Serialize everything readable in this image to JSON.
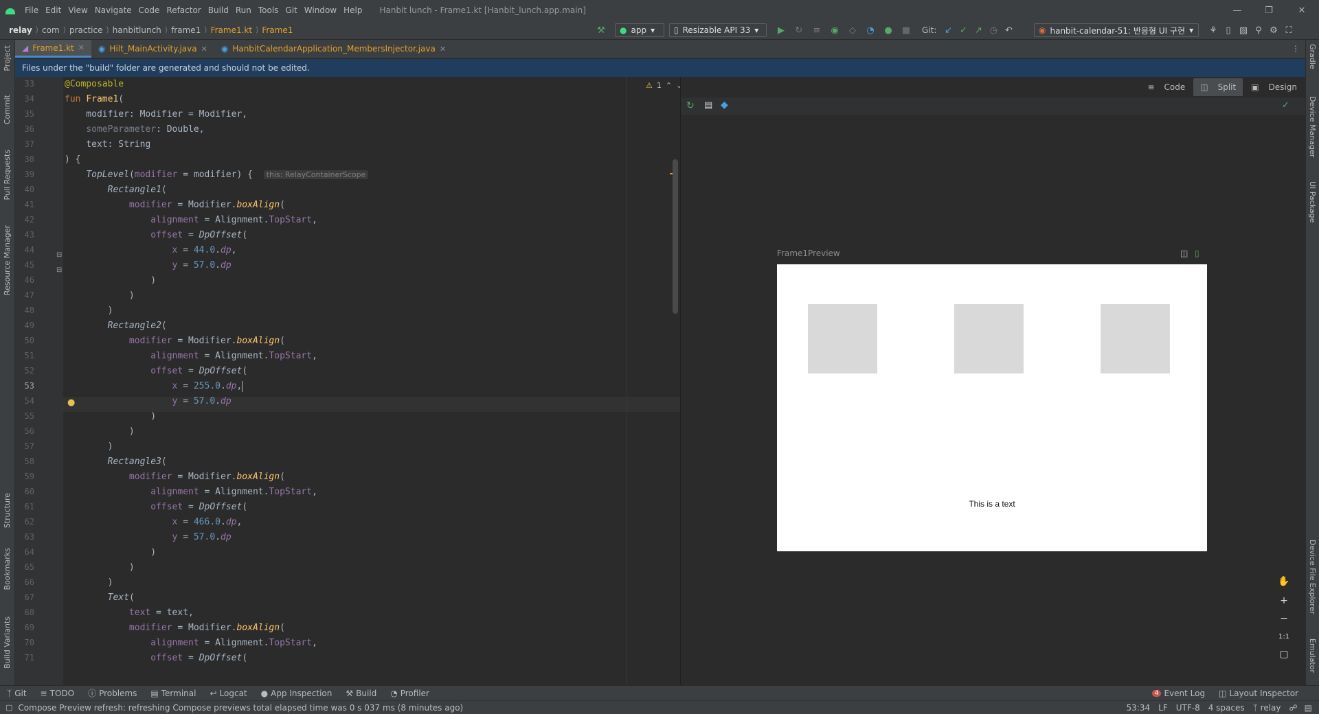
{
  "title_bar": {
    "menu": [
      "File",
      "Edit",
      "View",
      "Navigate",
      "Code",
      "Refactor",
      "Build",
      "Run",
      "Tools",
      "Git",
      "Window",
      "Help"
    ],
    "window_title": "Hanbit lunch - Frame1.kt [Hanbit_lunch.app.main]"
  },
  "nav_bar": {
    "breadcrumb": [
      "relay",
      "com",
      "practice",
      "hanbitlunch",
      "frame1",
      "Frame1.kt",
      "Frame1"
    ],
    "run_config": "app",
    "device": "Resizable API 33",
    "git_label": "Git:",
    "branch": "hanbit-calendar-51: 반응형 UI 구현"
  },
  "left_tool_windows": [
    "Project",
    "Commit",
    "Pull Requests",
    "Resource Manager",
    "Structure",
    "Bookmarks",
    "Build Variants"
  ],
  "right_tool_windows": [
    "Gradle",
    "Device Manager",
    "UI Package",
    "Device File Explorer",
    "Emulator"
  ],
  "tabs": [
    {
      "label": "Frame1.kt",
      "active": true
    },
    {
      "label": "Hilt_MainActivity.java",
      "active": false
    },
    {
      "label": "HanbitCalendarApplication_MembersInjector.java",
      "active": false
    }
  ],
  "banner": "Files under the \"build\" folder are generated and should not be edited.",
  "warnings": "1",
  "line_numbers": [
    "33",
    "34",
    "35",
    "36",
    "37",
    "38",
    "39",
    "40",
    "41",
    "42",
    "43",
    "44",
    "45",
    "46",
    "47",
    "48",
    "49",
    "50",
    "51",
    "52",
    "53",
    "54",
    "55",
    "56",
    "57",
    "58",
    "59",
    "60",
    "61",
    "62",
    "63",
    "64",
    "65",
    "66",
    "67",
    "68",
    "69",
    "70",
    "71"
  ],
  "inlay_hint": "this: RelayContainerScope",
  "preview": {
    "view_modes": {
      "code": "Code",
      "split": "Split",
      "design": "Design"
    },
    "frame_title": "Frame1Preview",
    "frame_text": "This is a text",
    "zoom_fit": "1:1"
  },
  "bottom_tools": [
    "Git",
    "TODO",
    "Problems",
    "Terminal",
    "Logcat",
    "App Inspection",
    "Build",
    "Profiler"
  ],
  "bottom_right": {
    "event_log": "Event Log",
    "event_count": "4",
    "layout_inspector": "Layout Inspector"
  },
  "status": {
    "message": "Compose Preview refresh: refreshing Compose previews total elapsed time was 0 s 037 ms (8 minutes ago)",
    "position": "53:34",
    "line_sep": "LF",
    "encoding": "UTF-8",
    "indent": "4 spaces",
    "vcs": "relay"
  },
  "colors": {
    "accent": "#4a88c7",
    "banner_bg": "#213d5e",
    "keyword": "#cc7832",
    "function": "#ffc66d",
    "number": "#6897bb",
    "param": "#9876aa",
    "annotation": "#bbb529"
  }
}
